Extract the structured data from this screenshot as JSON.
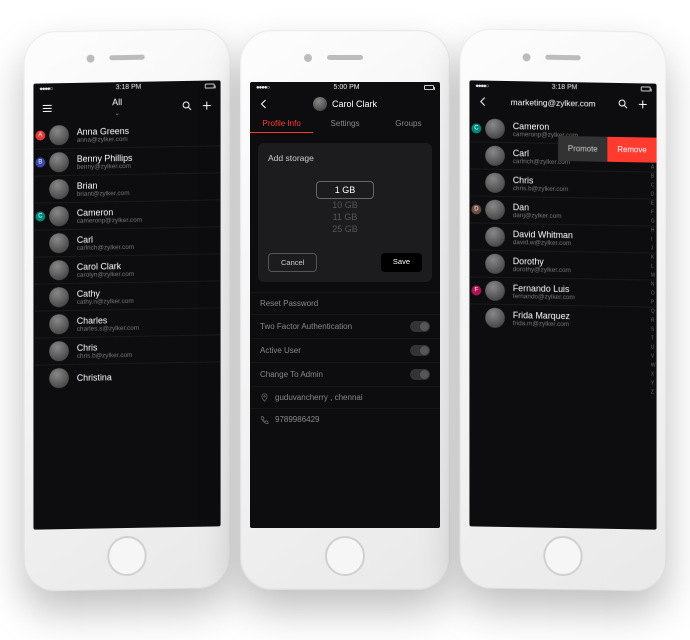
{
  "phone1": {
    "time": "3:18 PM",
    "title": "All",
    "contacts": [
      {
        "letter": "A",
        "name": "Anna Greens",
        "email": "anna@zylker.com"
      },
      {
        "letter": "B",
        "name": "Benny Phillips",
        "email": "benny@zylker.com"
      },
      {
        "letter": "",
        "name": "Brian",
        "email": "briant@zylker.com"
      },
      {
        "letter": "C",
        "name": "Cameron",
        "email": "cameronp@zylker.com"
      },
      {
        "letter": "",
        "name": "Carl",
        "email": "carlrich@zylker.com"
      },
      {
        "letter": "",
        "name": "Carol Clark",
        "email": "carolyn@zylker.com"
      },
      {
        "letter": "",
        "name": "Cathy",
        "email": "cathy.n@zylker.com"
      },
      {
        "letter": "",
        "name": "Charles",
        "email": "charles.s@zylker.com"
      },
      {
        "letter": "",
        "name": "Chris",
        "email": "chris.b@zylker.com"
      },
      {
        "letter": "",
        "name": "Christina",
        "email": ""
      }
    ]
  },
  "phone2": {
    "time": "5:00 PM",
    "title": "Carol Clark",
    "tabs": [
      "Profile Info",
      "Settings",
      "Groups"
    ],
    "card_title": "Add storage",
    "options": [
      "1 GB",
      "10 GB",
      "11 GB",
      "25 GB"
    ],
    "cancel": "Cancel",
    "save": "Save",
    "rows": [
      {
        "label": "Reset Password",
        "toggle": false
      },
      {
        "label": "Two Factor Authentication",
        "toggle": true
      },
      {
        "label": "Active User",
        "toggle": true
      },
      {
        "label": "Change To Admin",
        "toggle": true
      }
    ],
    "location": "guduvancherry , chennai",
    "phone": "9789986429"
  },
  "phone3": {
    "time": "3:18 PM",
    "title": "marketing@zylker.com",
    "promote": "Promote",
    "remove": "Remove",
    "contacts": [
      {
        "letter": "C",
        "name": "Cameron",
        "email": "cameronp@zylker.com"
      },
      {
        "letter": "",
        "name": "Carl",
        "email": "carlrich@zylker.com"
      },
      {
        "letter": "",
        "name": "Chris",
        "email": "chris.b@zylker.com"
      },
      {
        "letter": "D",
        "name": "Dan",
        "email": "danj@zylker.com"
      },
      {
        "letter": "",
        "name": "David Whitman",
        "email": "david.w@zylker.com"
      },
      {
        "letter": "",
        "name": "Dorothy",
        "email": "dorothy@zylker.com"
      },
      {
        "letter": "F",
        "name": "Fernando Luis",
        "email": "fernando@zylker.com"
      },
      {
        "letter": "",
        "name": "Frida Marquez",
        "email": "frida.m@zylker.com"
      }
    ],
    "index": [
      "A",
      "B",
      "C",
      "D",
      "E",
      "F",
      "G",
      "H",
      "I",
      "J",
      "K",
      "L",
      "M",
      "N",
      "O",
      "P",
      "Q",
      "R",
      "S",
      "T",
      "U",
      "V",
      "W",
      "X",
      "Y",
      "Z"
    ]
  }
}
